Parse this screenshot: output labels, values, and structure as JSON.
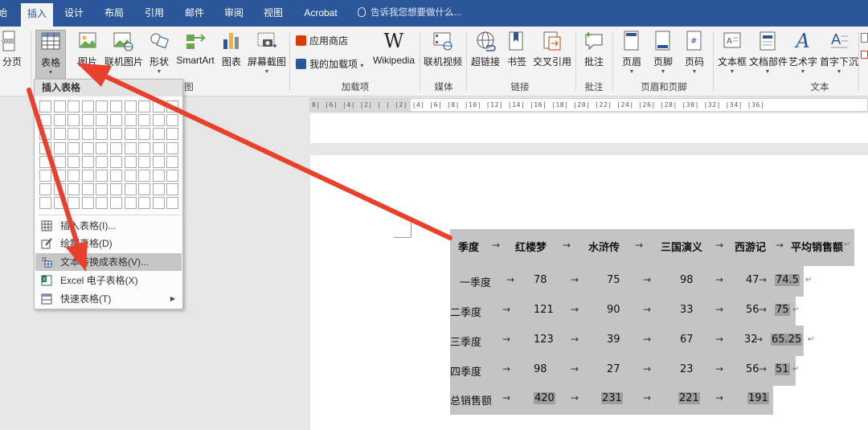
{
  "tabs": [
    {
      "label": "始",
      "active": false
    },
    {
      "label": "插入",
      "active": true
    },
    {
      "label": "设计",
      "active": false
    },
    {
      "label": "布局",
      "active": false
    },
    {
      "label": "引用",
      "active": false
    },
    {
      "label": "邮件",
      "active": false
    },
    {
      "label": "审阅",
      "active": false
    },
    {
      "label": "视图",
      "active": false
    },
    {
      "label": "Acrobat",
      "active": false
    }
  ],
  "tell_me": "告诉我您想要做什么...",
  "ribbon": {
    "page_break": "分页",
    "table": "表格",
    "picture": "图片",
    "online_picture": "联机图片",
    "shapes": "形状",
    "smartart": "SmartArt",
    "chart": "图表",
    "screenshot": "屏幕截图",
    "illustrations_group": "图",
    "store": "应用商店",
    "my_addins": "我的加载项",
    "wikipedia": "Wikipedia",
    "addins_group": "加载项",
    "online_video": "联机视频",
    "media_group": "媒体",
    "hyperlink": "超链接",
    "bookmark": "书签",
    "cross_ref": "交叉引用",
    "links_group": "链接",
    "comment": "批注",
    "comments_group": "批注",
    "header": "页眉",
    "footer": "页脚",
    "page_number": "页码",
    "header_footer_group": "页眉和页脚",
    "textbox": "文本框",
    "quick_parts": "文档部件",
    "wordart": "艺术字",
    "drop_cap": "首字下沉",
    "text_group": "文本"
  },
  "colors": {
    "tabbar": "#2b579a",
    "arrow": "#e8402a",
    "highlight": "#c4c4c4"
  },
  "dropdown": {
    "title": "插入表格",
    "grid_cols": 10,
    "grid_rows": 8,
    "items": [
      {
        "label": "插入表格(I)...",
        "icon": "insert-table-icon"
      },
      {
        "label": "绘制表格(D)",
        "icon": "draw-table-icon"
      },
      {
        "label": "文本转换成表格(V)...",
        "icon": "text-to-table-icon",
        "hover": true
      },
      {
        "label": "Excel 电子表格(X)",
        "icon": "excel-icon"
      },
      {
        "label": "快速表格(T)",
        "icon": "quick-table-icon",
        "submenu": true
      }
    ]
  },
  "ruler_text": "8| |6| |4| |2| |  | |2| |4| |6| |8| |10| |12| |14| |16| |18| |20| |22| |24| |26| |28| |30| |32| |34| |36|",
  "document": {
    "header": [
      "季度",
      "→",
      "红楼梦",
      "→",
      "水浒传",
      "→",
      "三国演义",
      "→",
      "西游记",
      "→",
      "平均销售额",
      "↵"
    ],
    "rows": [
      {
        "label": "一季度",
        "v": [
          "78",
          "75",
          "98",
          "47"
        ],
        "avg": "74.5"
      },
      {
        "label": "二季度",
        "v": [
          "121",
          "90",
          "33",
          "56"
        ],
        "avg": "75"
      },
      {
        "label": "三季度",
        "v": [
          "123",
          "39",
          "67",
          "32"
        ],
        "avg": "65.25"
      },
      {
        "label": "四季度",
        "v": [
          "98",
          "27",
          "23",
          "56"
        ],
        "avg": "51"
      },
      {
        "label": "总销售额",
        "v": [
          "420",
          "231",
          "221",
          "191"
        ],
        "avg": ""
      }
    ]
  }
}
